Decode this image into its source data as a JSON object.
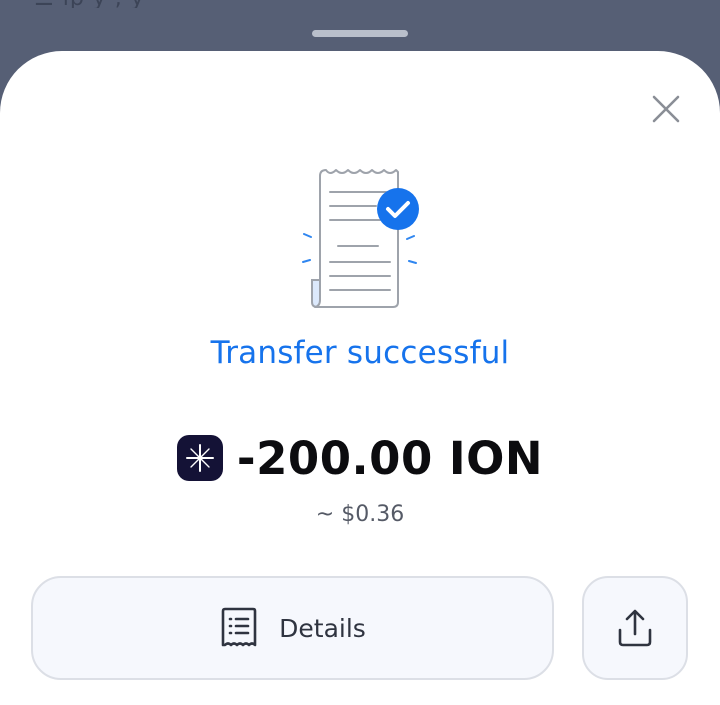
{
  "background": {
    "peek_text": "☰ ip                 y           ,          y"
  },
  "sheet": {
    "close_icon": "close-icon",
    "illustration_icon": "receipt-check-icon",
    "title": "Transfer successful",
    "amount": "-200.00 ION",
    "fiat_value": "~ $0.36",
    "coin_icon": "ion-coin-icon",
    "accent_color": "#1673ec"
  },
  "actions": {
    "details_label": "Details",
    "details_icon": "receipt-list-icon",
    "share_icon": "share-icon"
  }
}
